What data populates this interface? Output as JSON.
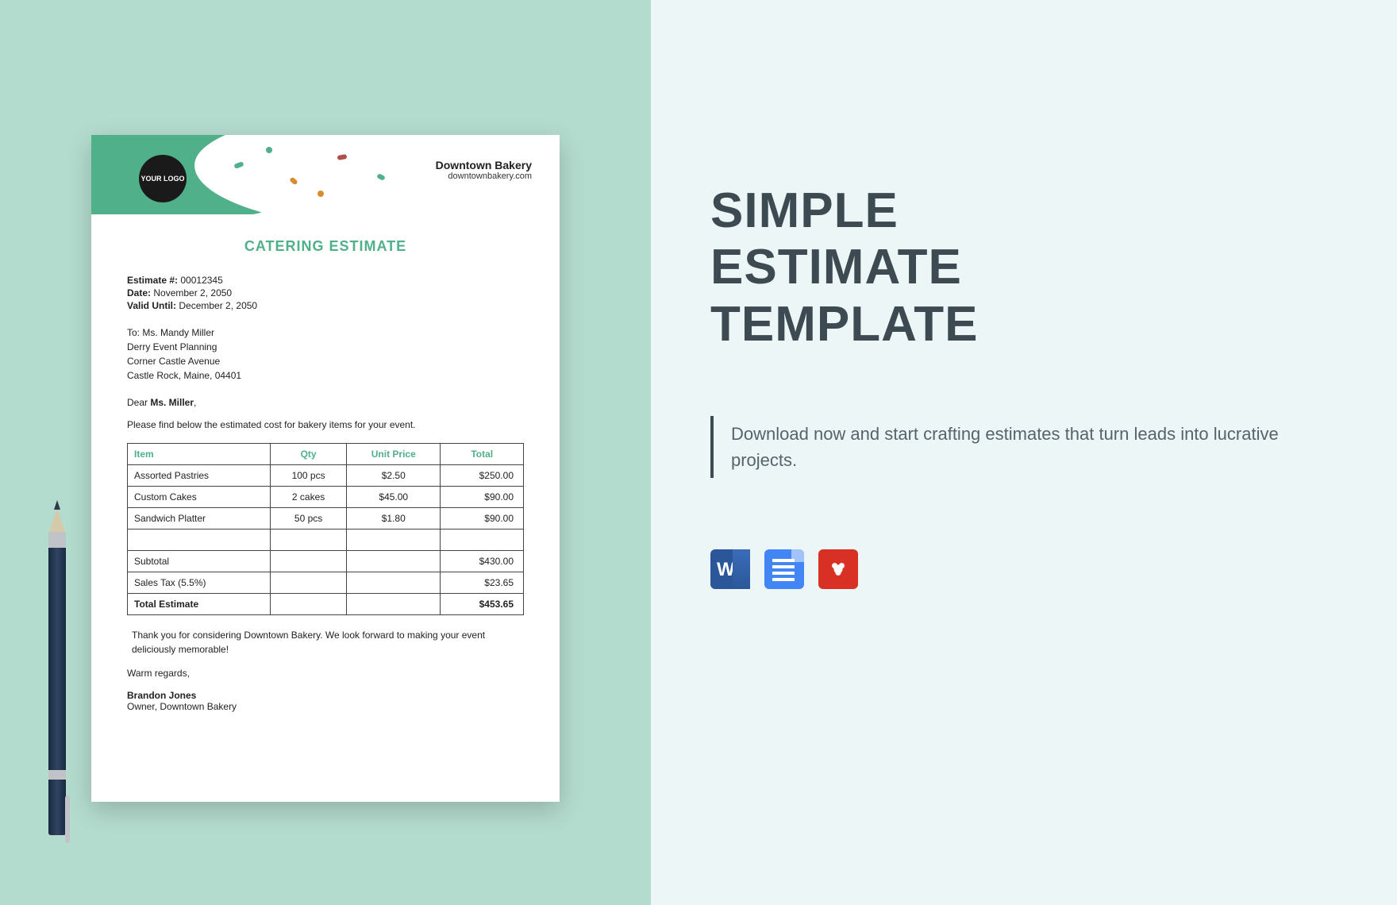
{
  "right": {
    "title_line1": "SIMPLE",
    "title_line2": "ESTIMATE",
    "title_line3": "TEMPLATE",
    "tagline": "Download now and start crafting estimates that turn leads into lucrative projects.",
    "formats": {
      "word": "Word",
      "gdoc": "Google Docs",
      "pdf": "PDF"
    }
  },
  "doc": {
    "logo_text": "YOUR LOGO",
    "company_name": "Downtown Bakery",
    "company_url": "downtownbakery.com",
    "title": "CATERING ESTIMATE",
    "meta": {
      "estimate_label": "Estimate #:",
      "estimate_value": "00012345",
      "date_label": "Date:",
      "date_value": "November 2, 2050",
      "valid_label": "Valid Until:",
      "valid_value": "December 2, 2050"
    },
    "to": {
      "line1": "To: Ms. Mandy Miller",
      "line2": "Derry Event Planning",
      "line3": "Corner Castle Avenue",
      "line4": "Castle Rock, Maine, 04401"
    },
    "dear_prefix": "Dear ",
    "dear_name": "Ms. Miller",
    "dear_suffix": ",",
    "intro": "Please find below the estimated cost for bakery items for your event.",
    "table": {
      "headers": {
        "item": "Item",
        "qty": "Qty",
        "unit": "Unit Price",
        "total": "Total"
      },
      "rows": [
        {
          "item": "Assorted Pastries",
          "qty": "100 pcs",
          "unit": "$2.50",
          "total": "$250.00"
        },
        {
          "item": "Custom Cakes",
          "qty": "2 cakes",
          "unit": "$45.00",
          "total": "$90.00"
        },
        {
          "item": "Sandwich Platter",
          "qty": "50 pcs",
          "unit": "$1.80",
          "total": "$90.00"
        }
      ],
      "subtotal_label": "Subtotal",
      "subtotal_value": "$430.00",
      "tax_label": "Sales Tax (5.5%)",
      "tax_value": "$23.65",
      "total_label": "Total Estimate",
      "total_value": "$453.65"
    },
    "thank_you": "Thank you for considering Downtown Bakery. We look forward to making your event deliciously memorable!",
    "warm": "Warm regards,",
    "signer_name": "Brandon Jones",
    "signer_title": "Owner, Downtown Bakery"
  }
}
